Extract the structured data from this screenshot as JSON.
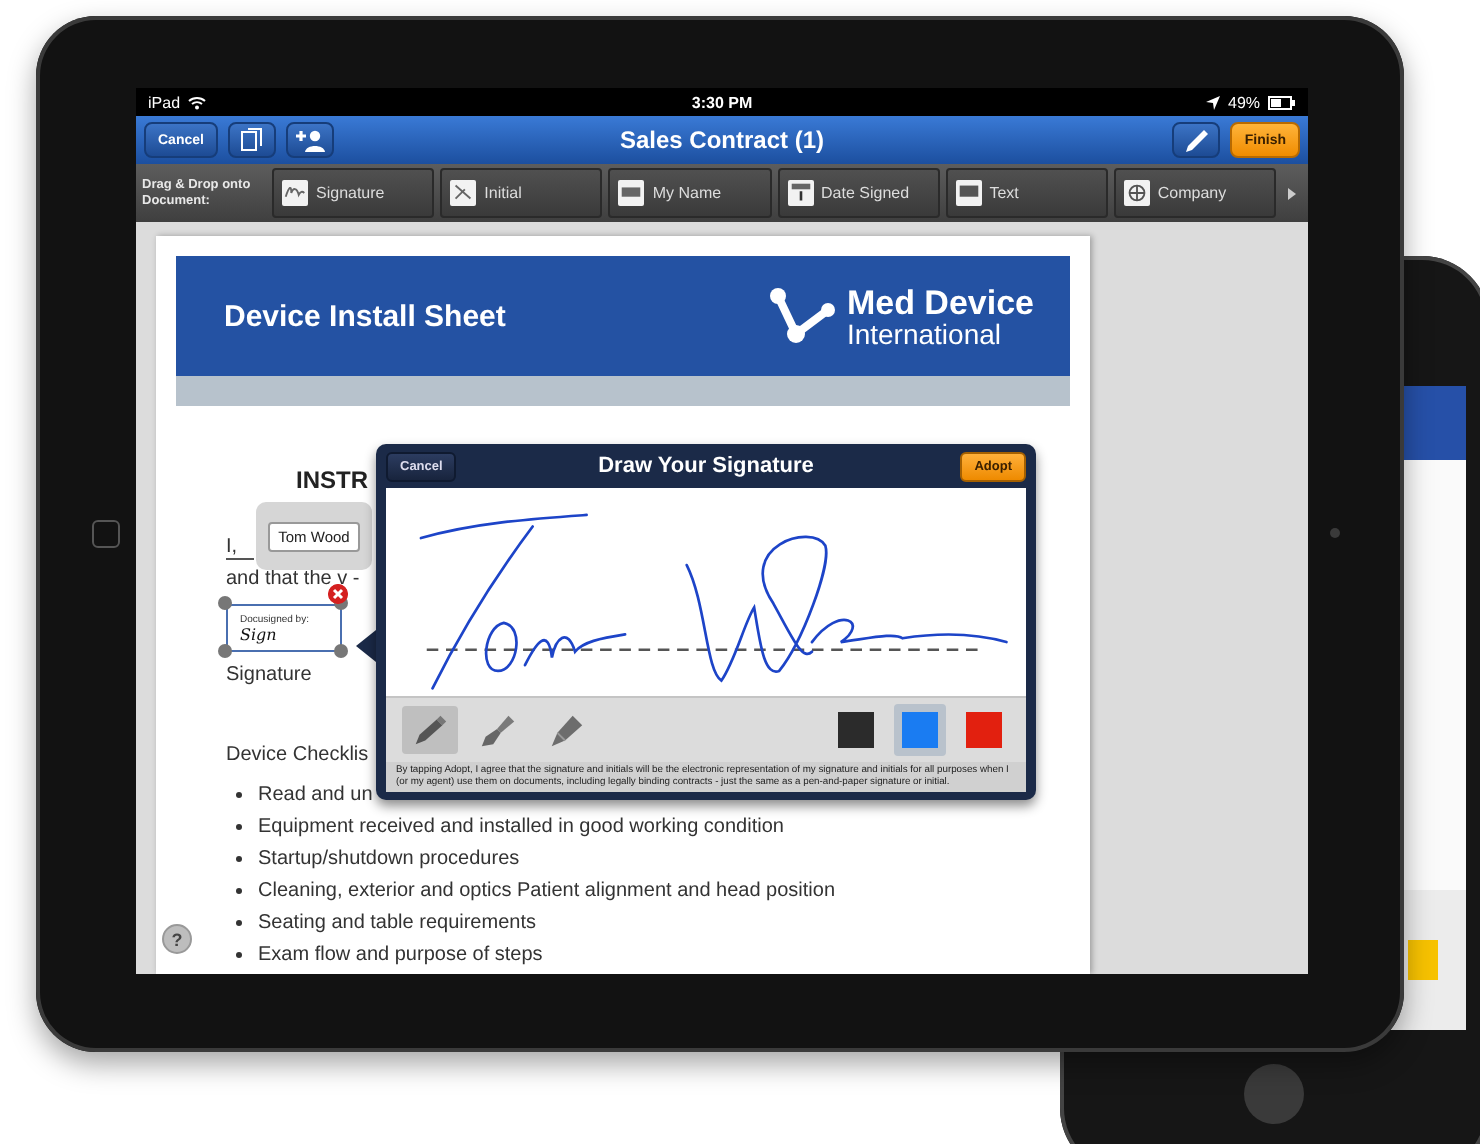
{
  "status_bar": {
    "device": "iPad",
    "time": "3:30 PM",
    "battery": "49%"
  },
  "nav_bar": {
    "cancel": "Cancel",
    "title": "Sales Contract (1)",
    "finish": "Finish"
  },
  "toolbar": {
    "label": "Drag & Drop onto Document:",
    "items": [
      {
        "kind": "signature",
        "label": "Signature"
      },
      {
        "kind": "initial",
        "label": "Initial"
      },
      {
        "kind": "name",
        "label": "My Name"
      },
      {
        "kind": "date",
        "label": "Date Signed"
      },
      {
        "kind": "text",
        "label": "Text"
      },
      {
        "kind": "company",
        "label": "Company"
      }
    ]
  },
  "document": {
    "header_title": "Device Install Sheet",
    "logo_line_1": "Med Device",
    "logo_line_2": "International",
    "heading": "INSTR",
    "name_field": "Tom Wood",
    "line_1": "I,",
    "line_2": "and that the v -",
    "signature_tag": {
      "label": "Docusigned by:",
      "value": "Sign"
    },
    "signature_caption": "Signature",
    "checklist_title": "Device Checklis",
    "checklist": [
      "Read and un",
      "Equipment received and installed in good working condition",
      "Startup/shutdown procedures",
      "Cleaning, exterior and optics Patient alignment and head position",
      "Seating and table requirements",
      "Exam flow and purpose of steps"
    ]
  },
  "help_button": "?",
  "signature_dialog": {
    "cancel": "Cancel",
    "title": "Draw Your Signature",
    "adopt": "Adopt",
    "tools": [
      {
        "kind": "pen",
        "selected": true
      },
      {
        "kind": "marker",
        "selected": false
      },
      {
        "kind": "highlighter",
        "selected": false
      }
    ],
    "colors": [
      {
        "color": "#2b2b2b",
        "selected": false
      },
      {
        "color": "#1a7cf2",
        "selected": true
      },
      {
        "color": "#e2200f",
        "selected": false
      }
    ],
    "disclaimer": "By tapping Adopt, I agree that the signature and initials will be the electronic representation of my signature and initials for all purposes when I (or my agent) use them on documents, including legally binding contracts - just the same as a pen-and-paper signature or initial."
  }
}
